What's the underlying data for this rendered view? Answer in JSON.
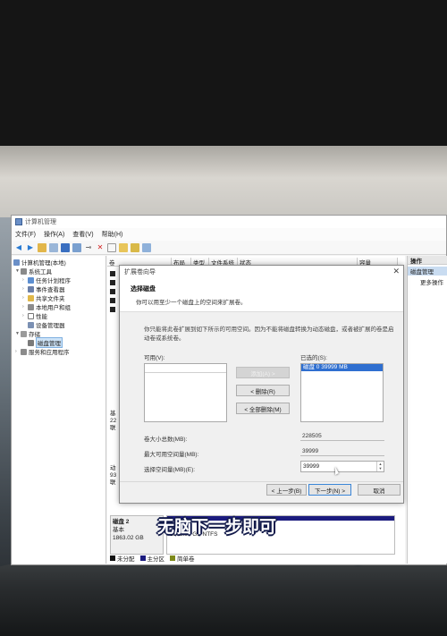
{
  "mmc": {
    "title": "计算机管理",
    "menu": [
      "文件(F)",
      "操作(A)",
      "查看(V)",
      "帮助(H)"
    ],
    "tree": [
      {
        "label": "计算机管理(本地)",
        "level": 0
      },
      {
        "label": "系统工具",
        "level": 1
      },
      {
        "label": "任务计划程序",
        "level": 2
      },
      {
        "label": "事件查看器",
        "level": 2
      },
      {
        "label": "共享文件夹",
        "level": 2
      },
      {
        "label": "本地用户和组",
        "level": 2
      },
      {
        "label": "性能",
        "level": 2
      },
      {
        "label": "设备管理器",
        "level": 2
      },
      {
        "label": "存储",
        "level": 1
      },
      {
        "label": "磁盘管理",
        "level": 2,
        "selected": true
      },
      {
        "label": "服务和应用程序",
        "level": 1
      }
    ],
    "columns": [
      "卷",
      "布局",
      "类型",
      "文件系统",
      "状态",
      "容量"
    ],
    "actions": {
      "header": "操作",
      "selected": "磁盘管理",
      "more": "更多操作"
    },
    "disk_rows_partial": [
      "基",
      "22",
      "联",
      "动",
      "93",
      "联"
    ],
    "disk2": {
      "name": "磁盘 2",
      "type": "基本",
      "size": "1863.02 GB",
      "volume_size": "1863.01 GB NTFS"
    },
    "legend": [
      "未分配",
      "主分区",
      "简单卷"
    ],
    "legend_colors": [
      "#111111",
      "#1b1b7e",
      "#7e8a1b"
    ]
  },
  "wizard": {
    "title": "扩展卷向导",
    "heading": "选择磁盘",
    "subheading": "你可以用至少一个磁盘上的空间来扩展卷。",
    "description": "你只能将此卷扩展到如下所示的可用空间。因为不能将磁盘转换为动态磁盘，或者被扩展的卷是启动卷或系统卷。",
    "available_label": "可用(V):",
    "selected_label": "已选的(S):",
    "selected_items": [
      "磁盘 0     39999 MB"
    ],
    "add_button": "添加(A) >",
    "remove_button": "< 删除(R)",
    "remove_all_button": "< 全部删除(M)",
    "total_size_label": "卷大小总数(MB):",
    "total_size_value": "228505",
    "max_space_label": "最大可用空间量(MB):",
    "max_space_value": "39999",
    "select_space_label": "选择空间量(MB)(E):",
    "select_space_value": "39999",
    "back_button": "< 上一步(B)",
    "next_button": "下一步(N) >",
    "cancel_button": "取消"
  },
  "caption": "无脑下一步即可"
}
